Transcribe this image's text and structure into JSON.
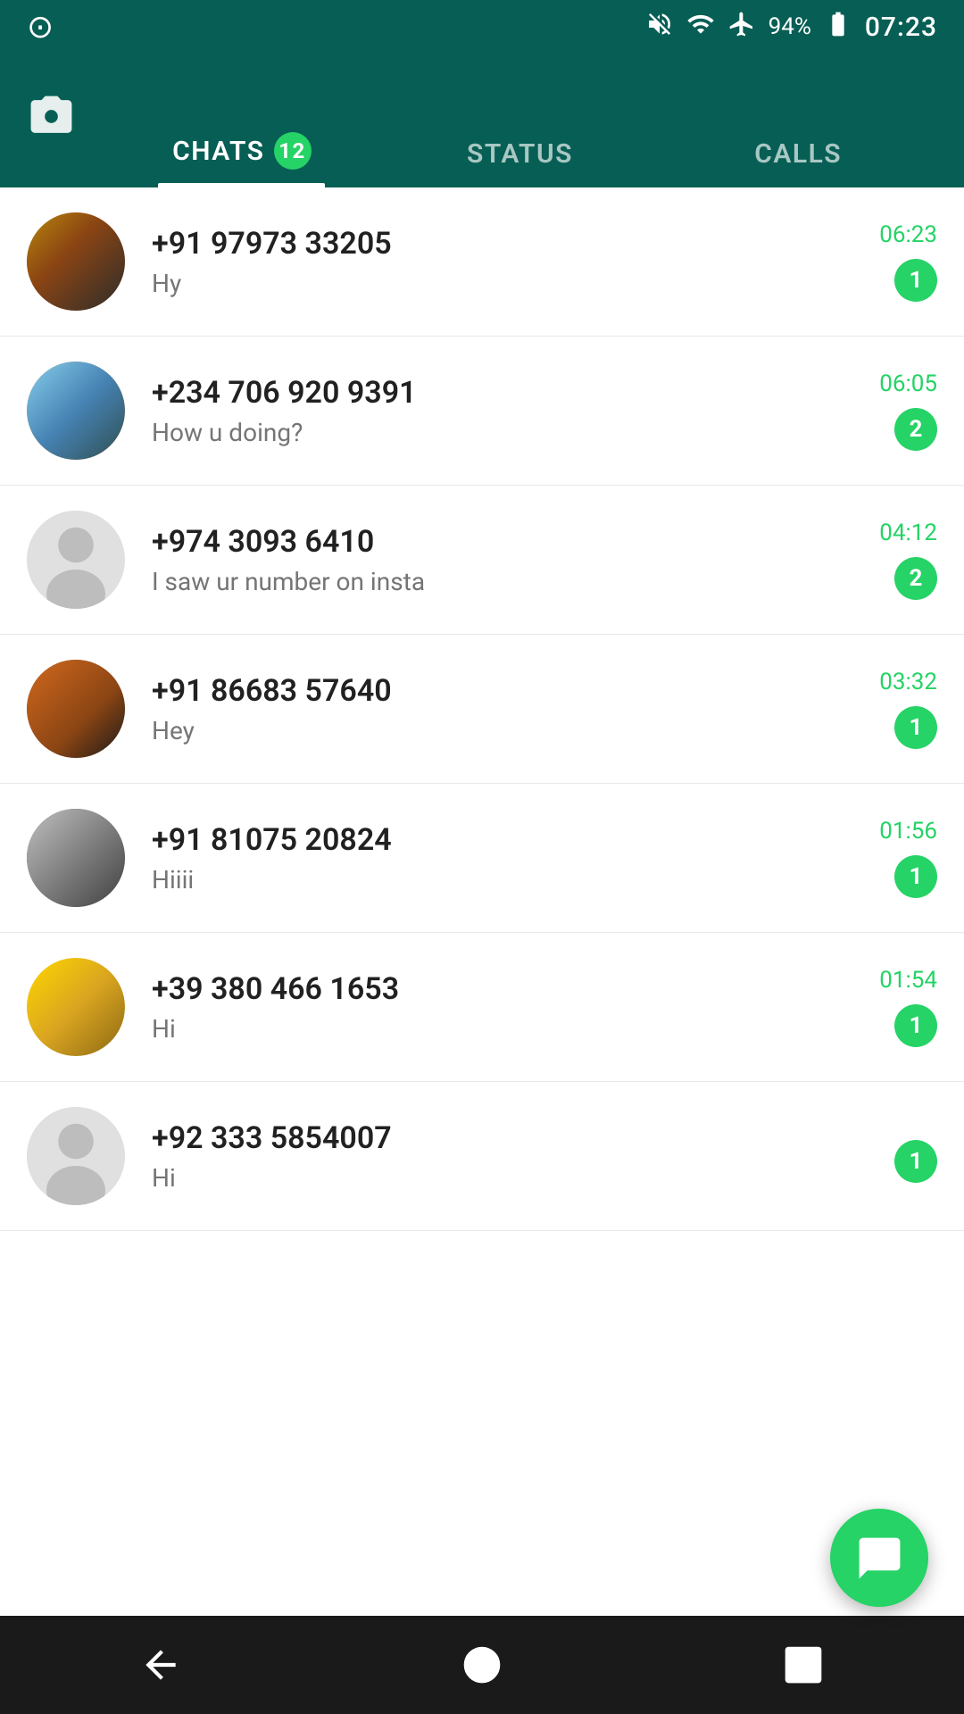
{
  "statusBar": {
    "time": "07:23",
    "battery": "94%"
  },
  "header": {
    "cameraLabel": "📷",
    "tabs": [
      {
        "id": "chats",
        "label": "CHATS",
        "badge": "12",
        "active": true
      },
      {
        "id": "status",
        "label": "STATUS",
        "badge": null,
        "active": false
      },
      {
        "id": "calls",
        "label": "CALLS",
        "badge": null,
        "active": false
      }
    ]
  },
  "chats": [
    {
      "id": 1,
      "name": "+91 97973 33205",
      "preview": "Hy",
      "time": "06:23",
      "unread": "1",
      "avatarType": "photo1"
    },
    {
      "id": 2,
      "name": "+234 706 920 9391",
      "preview": "How u doing?",
      "time": "06:05",
      "unread": "2",
      "avatarType": "photo2"
    },
    {
      "id": 3,
      "name": "+974 3093 6410",
      "preview": "I saw ur number on insta",
      "time": "04:12",
      "unread": "2",
      "avatarType": "default"
    },
    {
      "id": 4,
      "name": "+91 86683 57640",
      "preview": "Hey",
      "time": "03:32",
      "unread": "1",
      "avatarType": "photo4"
    },
    {
      "id": 5,
      "name": "+91 81075 20824",
      "preview": "Hiiii",
      "time": "01:56",
      "unread": "1",
      "avatarType": "photo5"
    },
    {
      "id": 6,
      "name": "+39 380 466 1653",
      "preview": "Hi",
      "time": "01:54",
      "unread": "1",
      "avatarType": "photo6"
    },
    {
      "id": 7,
      "name": "+92 333 5854007",
      "preview": "Hi",
      "time": "",
      "unread": "1",
      "avatarType": "default"
    }
  ],
  "fab": {
    "label": "New Chat"
  },
  "bottomNav": {
    "buttons": [
      "back",
      "home",
      "recents"
    ]
  }
}
